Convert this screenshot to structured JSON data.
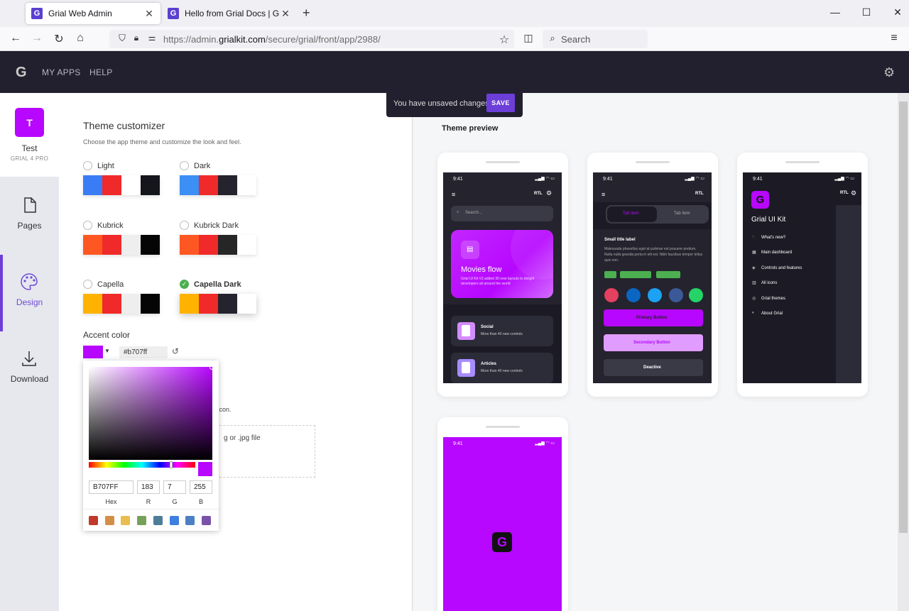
{
  "browser": {
    "tabs": [
      {
        "title": "Grial Web Admin",
        "active": true
      },
      {
        "title": "Hello from Grial Docs | Grial Doc",
        "active": false
      }
    ],
    "url_prefix": "https://admin.",
    "url_domain": "grialkit.com",
    "url_path": "/secure/grial/front/app/2988/",
    "search_placeholder": "Search"
  },
  "header": {
    "logo": "G",
    "menu": [
      "MY APPS",
      "HELP"
    ]
  },
  "toast": {
    "message": "You have unsaved changes",
    "save_label": "SAVE"
  },
  "sidebar": {
    "project_initial": "T",
    "project_name": "Test",
    "project_edition": "GRIAL 4 PRO",
    "items": [
      {
        "label": "Pages",
        "icon": "page-icon"
      },
      {
        "label": "Design",
        "icon": "palette-icon"
      },
      {
        "label": "Download",
        "icon": "download-icon"
      }
    ]
  },
  "theme": {
    "title": "Theme customizer",
    "subtitle": "Choose the app theme and customize the look and feel.",
    "options": [
      {
        "name": "Light",
        "selected": false,
        "colors": [
          "#3a7cf6",
          "#f02a2a",
          "#ffffff",
          "#15161c"
        ]
      },
      {
        "name": "Dark",
        "selected": false,
        "colors": [
          "#3c8ff5",
          "#f02a2a",
          "#24232e",
          "#ffffff"
        ]
      },
      {
        "name": "Kubrick",
        "selected": false,
        "colors": [
          "#ff5722",
          "#f02a2a",
          "#eeeeee",
          "#050505"
        ]
      },
      {
        "name": "Kubrick Dark",
        "selected": false,
        "colors": [
          "#ff5722",
          "#f02a2a",
          "#262626",
          "#ffffff"
        ]
      },
      {
        "name": "Capella",
        "selected": false,
        "colors": [
          "#ffb300",
          "#f02a2a",
          "#eeeeee",
          "#050505"
        ]
      },
      {
        "name": "Capella Dark",
        "selected": true,
        "colors": [
          "#ffb300",
          "#f02a2a",
          "#24232e",
          "#ffffff"
        ]
      }
    ],
    "accent_label": "Accent color",
    "accent_color": "#b707ff",
    "accent_hex": "#b707ff",
    "hidden_text1": "p icon.",
    "hidden_text2": "g or .jpg file"
  },
  "picker": {
    "hex": "B707FF",
    "r": "183",
    "g": "7",
    "b": "255",
    "labels": {
      "hex": "Hex",
      "r": "R",
      "g": "G",
      "b": "B"
    },
    "palette": [
      "#c0392b",
      "#d38f47",
      "#e9bd50",
      "#76a05a",
      "#4e7d9a",
      "#3f7fe0",
      "#4d7fc4",
      "#7a52a8"
    ]
  },
  "preview": {
    "title": "Theme preview",
    "phone1": {
      "time": "9:41",
      "rtl": "RTL",
      "search": "Search...",
      "card_title": "Movies flow",
      "card_text": "Grial UI Kit V3 added 30 new layouts to delight developers all around the world",
      "item1_title": "Social",
      "item1_sub": "More than 40 new controls",
      "item2_title": "Articles",
      "item2_sub": "More than 40 new controls"
    },
    "phone2": {
      "time": "9:41",
      "rtl": "RTL",
      "tab1": "Tab item",
      "tab2": "Tab item",
      "label": "Small title label",
      "para": "Malesuada phasellus eget at pulvinar est posuere pretium. Nulla nulla gravida porta in elit est. Nibh faucibus tempor tellus quis non.",
      "primary": "Primary Button",
      "secondary": "Secondary Button",
      "deactive": "Deactive"
    },
    "phone3": {
      "time": "9:41",
      "rtl": "RTL",
      "kit_title": "Grial UI Kit",
      "menu": [
        "What's new?",
        "Main dashboard",
        "Controls and features",
        "All icons",
        "Grial themes",
        "About Grial"
      ]
    },
    "phone4": {
      "time": "9:41"
    }
  }
}
